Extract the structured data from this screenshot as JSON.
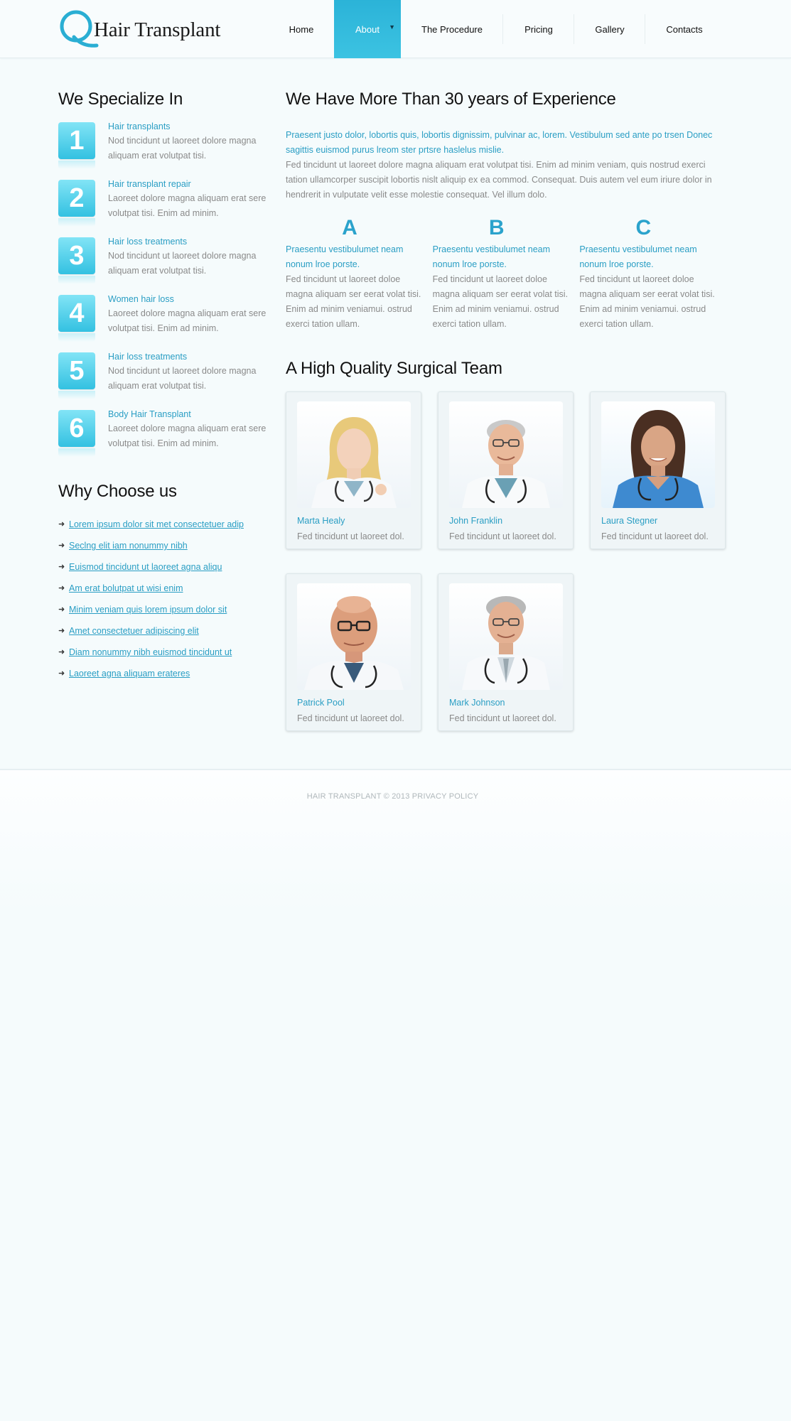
{
  "brand": {
    "logo_letter": "Q",
    "name": "Hair Transplant",
    "accent": "#2bb3d8"
  },
  "nav": {
    "items": [
      {
        "label": "Home"
      },
      {
        "label": "About",
        "active": true
      },
      {
        "label": "The Procedure"
      },
      {
        "label": "Pricing"
      },
      {
        "label": "Gallery"
      },
      {
        "label": "Contacts"
      }
    ]
  },
  "specialize": {
    "title": "We Specialize In",
    "items": [
      {
        "num": "1",
        "title": "Hair transplants",
        "desc": "Nod tincidunt ut laoreet dolore magna aliquam erat volutpat tisi."
      },
      {
        "num": "2",
        "title": "Hair transplant repair",
        "desc": "Laoreet dolore magna aliquam erat sere volutpat tisi. Enim ad minim."
      },
      {
        "num": "3",
        "title": "Hair loss treatments",
        "desc": "Nod tincidunt ut laoreet dolore magna aliquam erat volutpat tisi."
      },
      {
        "num": "4",
        "title": "Women hair loss",
        "desc": "Laoreet dolore magna aliquam erat sere volutpat tisi. Enim ad minim."
      },
      {
        "num": "5",
        "title": "Hair loss treatments",
        "desc": "Nod tincidunt ut laoreet dolore magna aliquam erat volutpat tisi."
      },
      {
        "num": "6",
        "title": "Body Hair Transplant",
        "desc": "Laoreet dolore magna aliquam erat sere volutpat tisi. Enim ad minim."
      }
    ]
  },
  "why": {
    "title": "Why Choose us",
    "links": [
      "Lorem ipsum dolor sit met consectetuer adip",
      "Seclng elit iam nonummy nibh",
      "Euismod tincidunt ut laoreet agna aliqu",
      "Am erat bolutpat ut wisi enim",
      "Minim veniam quis lorem ipsum dolor sit",
      "Amet consectetuer adipiscing elit",
      "Diam nonummy nibh euismod tincidunt ut",
      "Laoreet agna aliquam erateres"
    ]
  },
  "experience": {
    "title": "We Have More Than 30 years of Experience",
    "intro_blue": "Praesent justo dolor, lobortis quis, lobortis dignissim, pulvinar ac, lorem. Vestibulum sed ante po trsen Donec sagittis euismod purus lreom ster prtsre haslelus mislie.",
    "intro_gray": "Fed tincidunt ut laoreet dolore magna aliquam erat volutpat tisi. Enim ad minim veniam, quis nostrud exerci tation ullamcorper suscipit lobortis nislt aliquip ex ea commod. Consequat. Duis autem vel eum iriure dolor in hendrerit in vulputate velit esse molestie consequat. Vel illum dolo.",
    "columns": [
      {
        "letter": "A",
        "blue": "Praesentu vestibulumet neam nonum lroe porste.",
        "gray": "Fed tincidunt ut laoreet doloe magna aliquam ser eerat volat tisi. Enim ad minim veniamui. ostrud exerci tation ullam."
      },
      {
        "letter": "B",
        "blue": "Praesentu vestibulumet neam nonum lroe porste.",
        "gray": "Fed tincidunt ut laoreet doloe magna aliquam ser eerat volat tisi. Enim ad minim veniamui. ostrud exerci tation ullam."
      },
      {
        "letter": "C",
        "blue": "Praesentu vestibulumet neam nonum lroe porste.",
        "gray": "Fed tincidunt ut laoreet doloe magna aliquam ser eerat volat tisi. Enim ad minim veniamui. ostrud exerci tation ullam."
      }
    ]
  },
  "team": {
    "title": "A High Quality Surgical Team",
    "members": [
      {
        "name": "Marta Healy",
        "desc": "Fed tincidunt ut laoreet dol.",
        "photo": "female-doctor-blonde-photo"
      },
      {
        "name": "John Franklin",
        "desc": "Fed tincidunt ut laoreet dol.",
        "photo": "male-doctor-glasses-photo"
      },
      {
        "name": "Laura Stegner",
        "desc": "Fed tincidunt ut laoreet dol.",
        "photo": "female-nurse-photo"
      },
      {
        "name": "Patrick Pool",
        "desc": "Fed tincidunt ut laoreet dol.",
        "photo": "male-doctor-bald-photo"
      },
      {
        "name": "Mark Johnson",
        "desc": "Fed tincidunt ut laoreet dol.",
        "photo": "male-doctor-gray-hair-photo"
      }
    ]
  },
  "footer": {
    "text": "HAIR TRANSPLANT © 2013 PRIVACY POLICY"
  }
}
